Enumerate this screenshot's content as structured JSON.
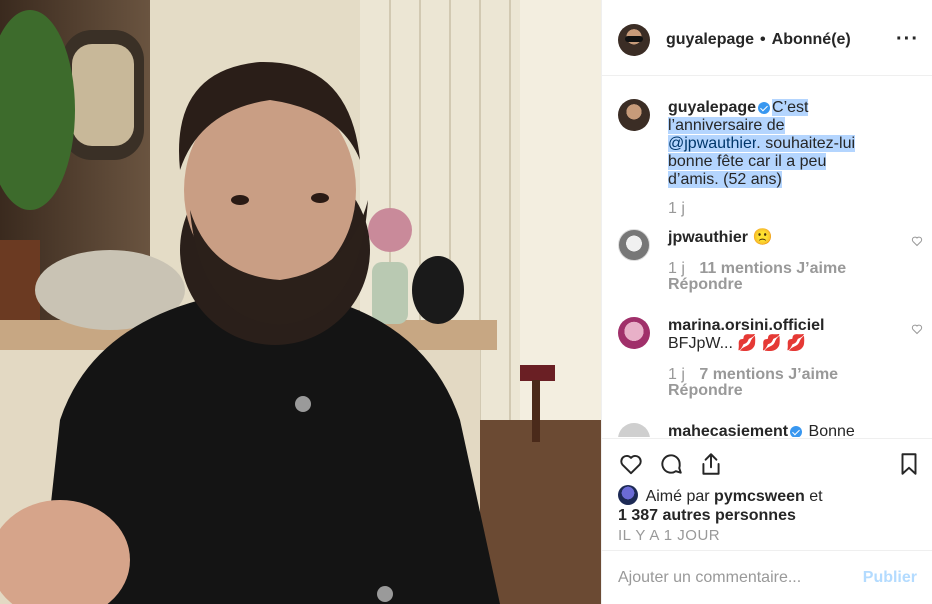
{
  "post": {
    "author": "guyalepage",
    "separator": "•",
    "follow_status": "Abonné(e)",
    "more_label": "···"
  },
  "caption": {
    "username": "guyalepage",
    "text_line1": "C’est",
    "text_line2": "l’anniversaire de",
    "mention": "@jpwauthier",
    "text_line3": ". souhaitez-lui",
    "text_line4": "bonne fête car il a peu",
    "text_line5": "d’amis. (52 ans)",
    "time": "1 j"
  },
  "comments": [
    {
      "username": "jpwauthier",
      "text": "🙁",
      "time": "1 j",
      "likes": "11 mentions J’aime",
      "reply": "Répondre"
    },
    {
      "username": "marina.orsini.officiel",
      "text": "BFJpW... 💋 💋 💋",
      "time": "1 j",
      "likes": "7 mentions J’aime",
      "reply": "Répondre"
    },
    {
      "username": "mahecasiement",
      "text": "Bonne"
    }
  ],
  "likes": {
    "prefix": "Aimé par",
    "user": "pymcsween",
    "conj": "et",
    "others": "1 387 autres personnes"
  },
  "posted_ago": "IL Y A 1 JOUR",
  "add_comment": {
    "placeholder": "Ajouter un commentaire...",
    "publish": "Publier"
  },
  "colors": {
    "accent": "#3897f0",
    "highlight": "#b4d5fe",
    "muted": "#999999"
  },
  "icons": [
    "heart-icon",
    "comment-icon",
    "share-icon",
    "bookmark-icon",
    "more-icon",
    "verified-icon"
  ]
}
